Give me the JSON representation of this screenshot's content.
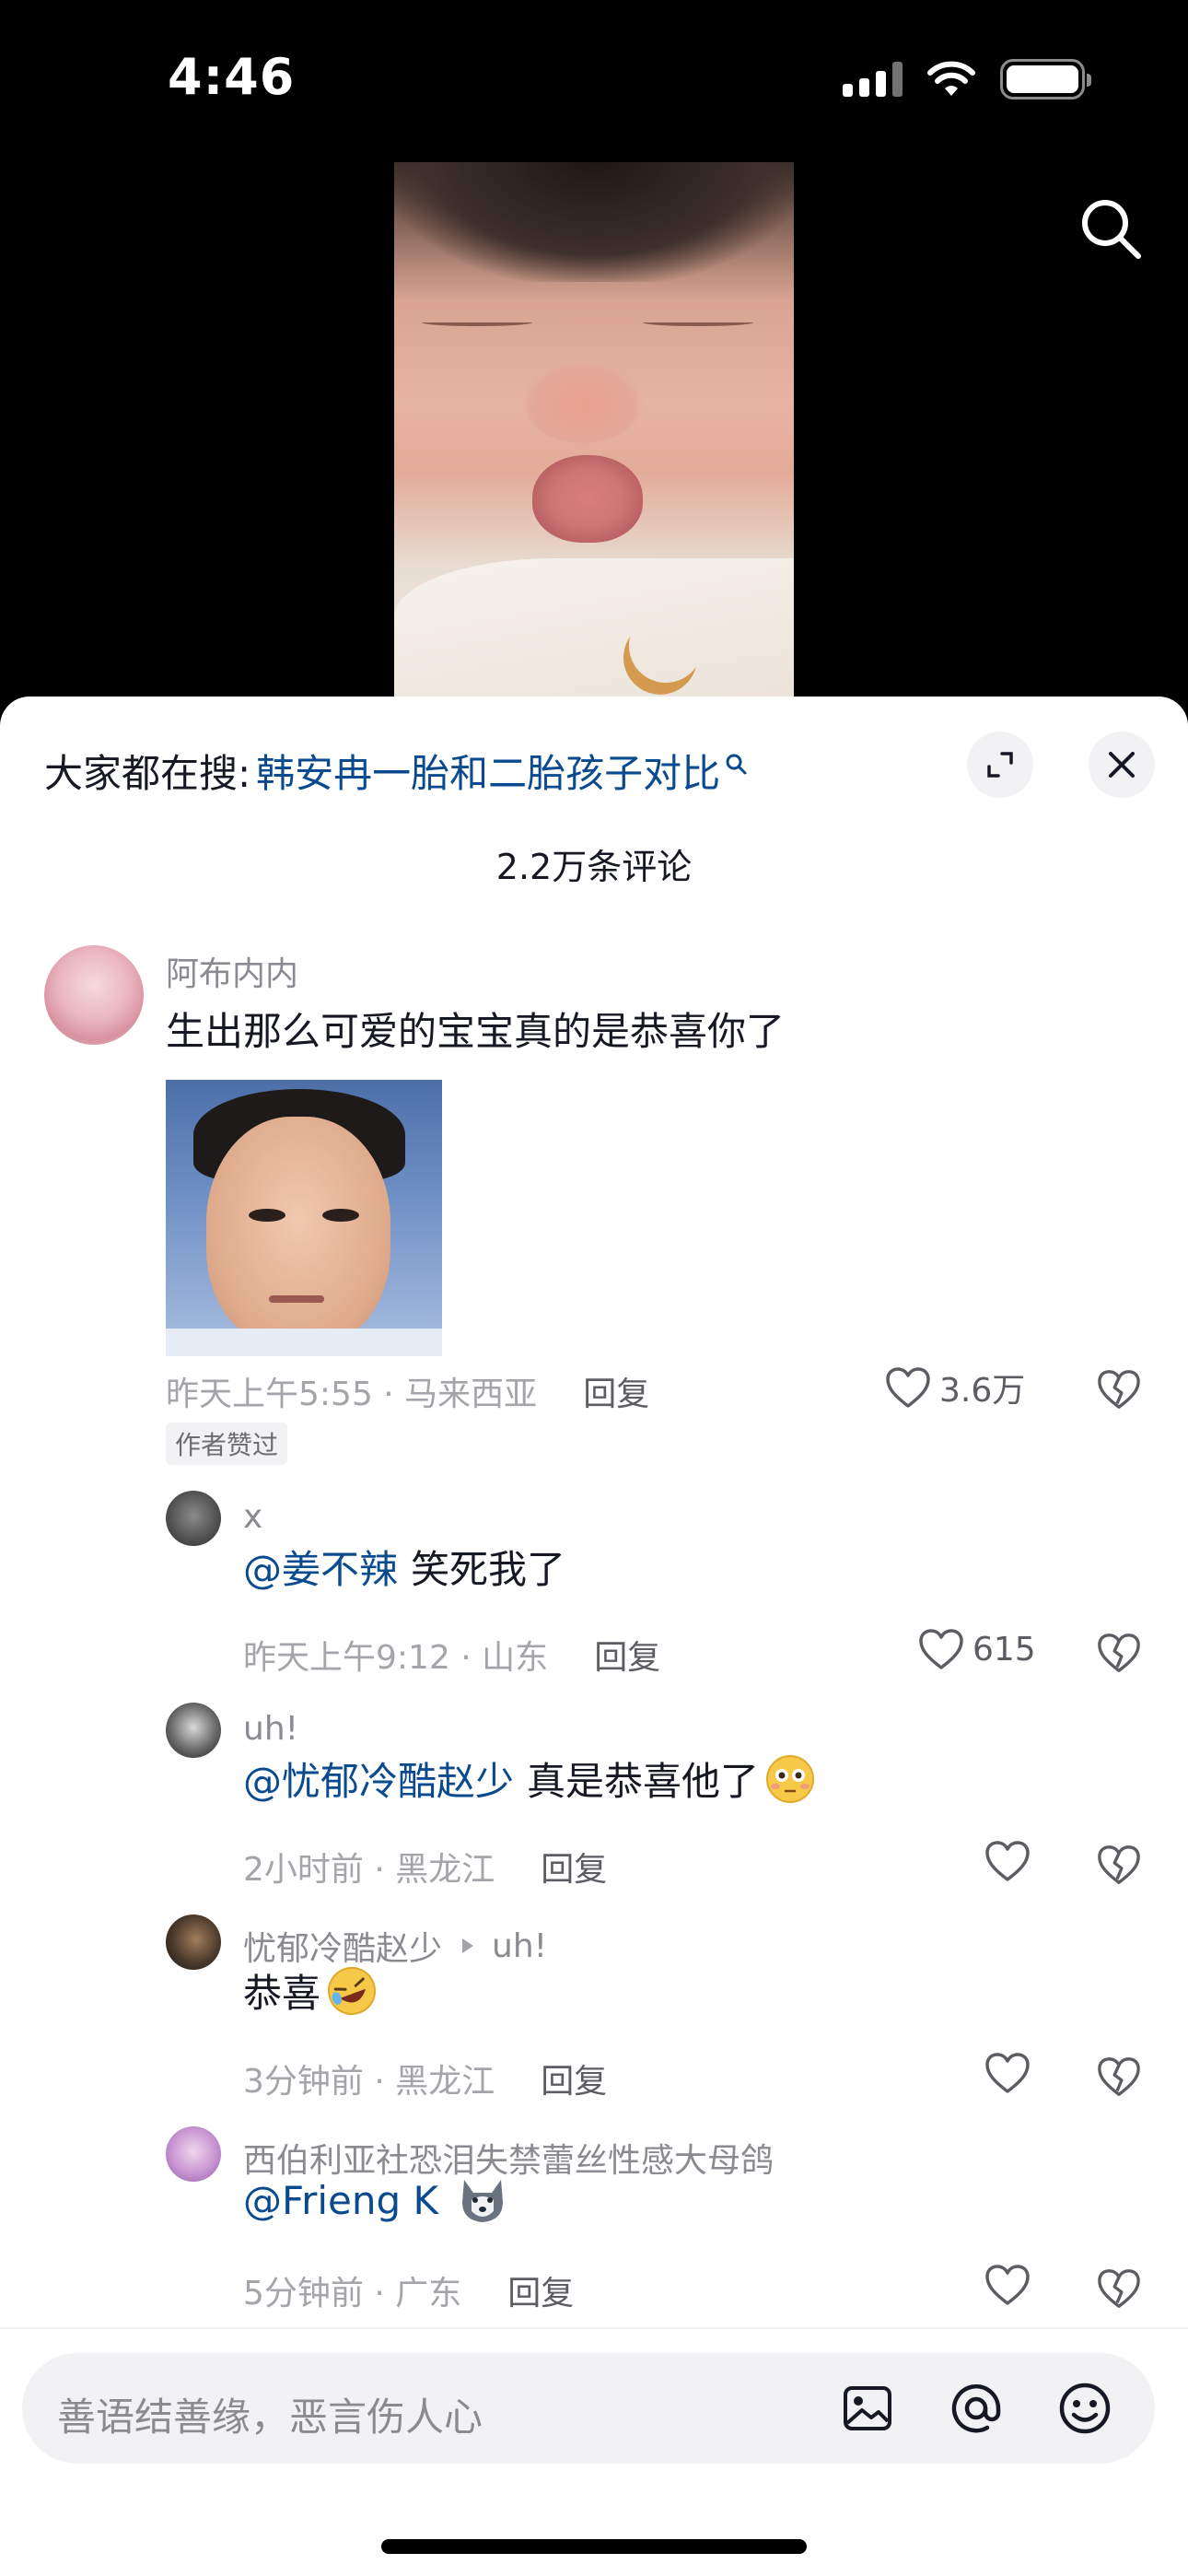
{
  "status_bar": {
    "time": "4:46"
  },
  "sheet": {
    "trending_prefix": "大家都在搜:",
    "trending_query": "韩安冉一胎和二胎孩子对比",
    "comment_count": "2.2万条评论"
  },
  "comments": [
    {
      "user": "阿布内内",
      "text": "生出那么可爱的宝宝真的是恭喜你了",
      "meta": "昨天上午5:55 · 马来西亚",
      "reply": "回复",
      "likes": "3.6万",
      "badge": "作者赞过"
    },
    {
      "user": "x",
      "mention": "@姜不辣",
      "text": "笑死我了",
      "meta": "昨天上午9:12 · 山东",
      "reply": "回复",
      "likes": "615"
    },
    {
      "user": "uh!",
      "mention": "@忧郁冷酷赵少",
      "text": "真是恭喜他了",
      "meta": "2小时前 · 黑龙江",
      "reply": "回复"
    },
    {
      "user": "忧郁冷酷赵少",
      "reply_to": "uh!",
      "text": "恭喜",
      "meta": "3分钟前 · 黑龙江",
      "reply": "回复"
    },
    {
      "user": "西伯利亚社恐泪失禁蕾丝性感大母鸽",
      "mention": "@Frieng K",
      "meta": "5分钟前 · 广东",
      "reply": "回复"
    }
  ],
  "input": {
    "placeholder": "善语结善缘，恶言伤人心"
  },
  "icons": [
    "search-icon",
    "expand-icon",
    "close-icon",
    "heart-icon",
    "broken-heart-icon",
    "image-icon",
    "at-icon",
    "emoji-icon"
  ]
}
